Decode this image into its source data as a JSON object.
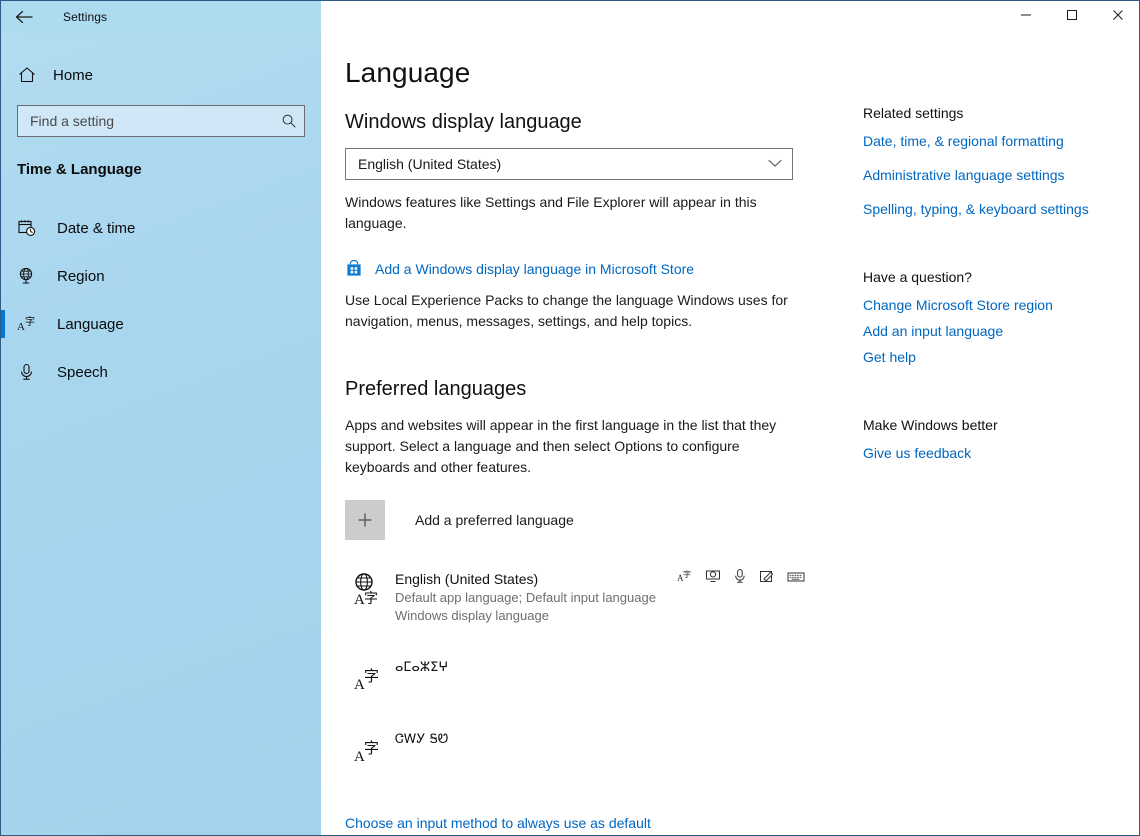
{
  "window": {
    "app_title": "Settings",
    "back_icon": "back-arrow-icon",
    "minimize_icon": "minimize-icon",
    "maximize_icon": "maximize-icon",
    "close_icon": "close-icon",
    "accent_color": "#0078d7",
    "link_color": "#0067c0",
    "sidebar_color": "#a8d6ef"
  },
  "sidebar": {
    "home_label": "Home",
    "home_icon": "home-icon",
    "search": {
      "placeholder": "Find a setting",
      "value": "",
      "icon": "search-icon"
    },
    "category": "Time & Language",
    "items": [
      {
        "label": "Date & time",
        "icon": "calendar-clock-icon",
        "selected": false
      },
      {
        "label": "Region",
        "icon": "globe-stand-icon",
        "selected": false
      },
      {
        "label": "Language",
        "icon": "language-a-zi-icon",
        "selected": true
      },
      {
        "label": "Speech",
        "icon": "microphone-icon",
        "selected": false
      }
    ]
  },
  "main": {
    "page_title": "Language",
    "display_language": {
      "heading": "Windows display language",
      "selected": "English (United States)",
      "chevron_icon": "chevron-down-icon",
      "description": "Windows features like Settings and File Explorer will appear in this language.",
      "store_link": "Add a Windows display language in Microsoft Store",
      "store_icon": "microsoft-store-icon",
      "lep_description": "Use Local Experience Packs to change the language Windows uses for navigation, menus, messages, settings, and help topics."
    },
    "preferred_languages": {
      "heading": "Preferred languages",
      "description": "Apps and websites will appear in the first language in the list that they support. Select a language and then select Options to configure keyboards and other features.",
      "add_label": "Add a preferred language",
      "add_icon": "plus-icon",
      "items": [
        {
          "name": "English (United States)",
          "sub1": "Default app language; Default input language",
          "sub2": "Windows display language",
          "glyph_icon": "globe-language-icon",
          "feature_icons": [
            "language-pack-icon",
            "display-text-icon",
            "speech-microphone-icon",
            "handwriting-pen-icon",
            "keyboard-icon"
          ]
        },
        {
          "name": "ⴰⵎⴰⵣⵉⵖ",
          "sub1": "",
          "sub2": "",
          "glyph_icon": "language-a-zi-icon",
          "feature_icons": []
        },
        {
          "name": "ᏣᎳᎩ ᎦᏬ",
          "sub1": "",
          "sub2": "",
          "glyph_icon": "language-a-zi-icon",
          "feature_icons": []
        }
      ],
      "default_input_link": "Choose an input method to always use as default"
    }
  },
  "related": {
    "heading": "Related settings",
    "links": [
      "Date, time, & regional formatting",
      "Administrative language settings",
      "Spelling, typing, & keyboard settings"
    ],
    "question_heading": "Have a question?",
    "question_links": [
      "Change Microsoft Store region",
      "Add an input language",
      "Get help"
    ],
    "feedback_heading": "Make Windows better",
    "feedback_link": "Give us feedback"
  }
}
